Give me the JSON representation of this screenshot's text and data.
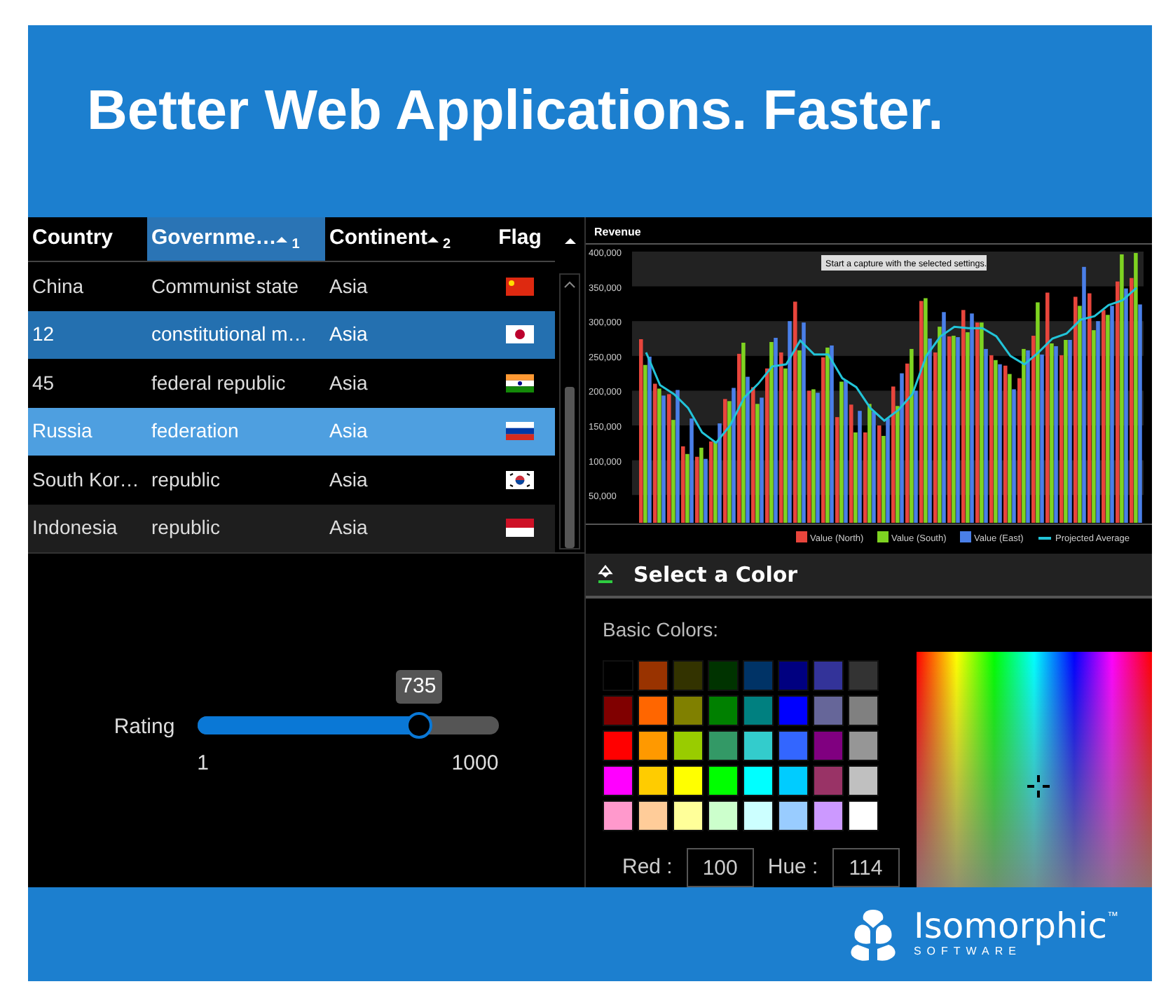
{
  "banner": {
    "title": "Better Web Applications. Faster."
  },
  "grid": {
    "columns": [
      {
        "label": "Country",
        "highlighted": false
      },
      {
        "label": "Governme…",
        "sort_rank": "1",
        "highlighted": true
      },
      {
        "label": "Continent",
        "sort_rank": "2",
        "highlighted": false
      },
      {
        "label": "Flag",
        "highlighted": false
      }
    ],
    "rows": [
      {
        "country": "China",
        "government": "Communist state",
        "continent": "Asia",
        "kind": "cn",
        "selected": false,
        "hovered": false,
        "shaded": false
      },
      {
        "country": "12",
        "government": "constitutional m…",
        "continent": "Asia",
        "kind": "jp",
        "selected": true,
        "hovered": false,
        "shaded": false
      },
      {
        "country": "45",
        "government": "federal republic",
        "continent": "Asia",
        "kind": "in",
        "selected": false,
        "hovered": false,
        "shaded": false
      },
      {
        "country": "Russia",
        "government": "federation",
        "continent": "Asia",
        "kind": "ru",
        "selected": false,
        "hovered": true,
        "shaded": false
      },
      {
        "country": "South Kor…",
        "government": "republic",
        "continent": "Asia",
        "kind": "kr",
        "selected": false,
        "hovered": false,
        "shaded": false
      },
      {
        "country": "Indonesia",
        "government": "republic",
        "continent": "Asia",
        "kind": "id",
        "selected": false,
        "hovered": false,
        "shaded": true
      }
    ]
  },
  "revenue": {
    "tooltip": "Start a capture with the selected settings.",
    "chart_data": {
      "type": "bar",
      "title": "Revenue",
      "ylim": [
        10000,
        405000
      ],
      "yticks": [
        {
          "value": 50000,
          "label": "50,000"
        },
        {
          "value": 100000,
          "label": "100,000"
        },
        {
          "value": 150000,
          "label": "150,000"
        },
        {
          "value": 200000,
          "label": "200,000"
        },
        {
          "value": 250000,
          "label": "250,000"
        },
        {
          "value": 300000,
          "label": "300,000"
        },
        {
          "value": 350000,
          "label": "350,000"
        },
        {
          "value": 400000,
          "label": "400,000"
        }
      ],
      "legend": "bottom-right",
      "series": [
        {
          "name": "Value (North)",
          "color": "#e8453c",
          "values": [
            274000,
            210000,
            195000,
            120000,
            105000,
            127000,
            188000,
            253000,
            205000,
            232000,
            255000,
            328000,
            200000,
            248000,
            162000,
            180000,
            140000,
            150000,
            206000,
            239000,
            329000,
            255000,
            278000,
            316000,
            298000,
            251000,
            236000,
            218000,
            279000,
            341000,
            251000,
            335000,
            340000,
            316000,
            357000,
            362000
          ]
        },
        {
          "name": "Value (South)",
          "color": "#7ed321",
          "values": [
            237000,
            203000,
            158000,
            109000,
            118000,
            127000,
            185000,
            269000,
            181000,
            270000,
            232000,
            258000,
            202000,
            262000,
            213000,
            140000,
            181000,
            135000,
            178000,
            260000,
            333000,
            292000,
            279000,
            284000,
            298000,
            244000,
            224000,
            260000,
            327000,
            268000,
            273000,
            322000,
            287000,
            309000,
            396000,
            398000
          ]
        },
        {
          "name": "Value (East)",
          "color": "#4a7fe8",
          "values": [
            249000,
            193000,
            201000,
            160000,
            102000,
            153000,
            204000,
            220000,
            190000,
            276000,
            300000,
            298000,
            197000,
            265000,
            215000,
            171000,
            170000,
            160000,
            225000,
            200000,
            275000,
            313000,
            277000,
            311000,
            260000,
            238000,
            202000,
            258000,
            252000,
            264000,
            273000,
            378000,
            300000,
            322000,
            347000,
            324000
          ]
        },
        {
          "name": "Projected Average",
          "type": "line",
          "color": "#22c4d8",
          "values": [
            255000,
            208000,
            195000,
            175000,
            140000,
            125000,
            150000,
            190000,
            210000,
            235000,
            238000,
            272000,
            252000,
            252000,
            218000,
            205000,
            175000,
            157000,
            172000,
            195000,
            250000,
            278000,
            292000,
            290000,
            290000,
            278000,
            250000,
            238000,
            255000,
            275000,
            282000,
            302000,
            307000,
            323000,
            330000,
            348000
          ]
        }
      ]
    }
  },
  "slider": {
    "label": "Rating",
    "value": "735",
    "level": 0.735,
    "min": "1",
    "max": "1000"
  },
  "color_picker": {
    "title": "Select a Color",
    "basic_label": "Basic Colors:",
    "swatches": [
      {
        "color": "#000000"
      },
      {
        "color": "#993300"
      },
      {
        "color": "#333300"
      },
      {
        "color": "#003300"
      },
      {
        "color": "#003366"
      },
      {
        "color": "#000080"
      },
      {
        "color": "#333399"
      },
      {
        "color": "#333333"
      },
      {
        "color": "#800000"
      },
      {
        "color": "#ff6600"
      },
      {
        "color": "#808000"
      },
      {
        "color": "#008000"
      },
      {
        "color": "#008080"
      },
      {
        "color": "#0000ff"
      },
      {
        "color": "#666699"
      },
      {
        "color": "#808080"
      },
      {
        "color": "#ff0000"
      },
      {
        "color": "#ff9900"
      },
      {
        "color": "#99cc00"
      },
      {
        "color": "#339966"
      },
      {
        "color": "#33cccc"
      },
      {
        "color": "#3366ff"
      },
      {
        "color": "#800080"
      },
      {
        "color": "#969696"
      },
      {
        "color": "#ff00ff"
      },
      {
        "color": "#ffcc00"
      },
      {
        "color": "#ffff00"
      },
      {
        "color": "#00ff00"
      },
      {
        "color": "#00ffff"
      },
      {
        "color": "#00ccff"
      },
      {
        "color": "#993366"
      },
      {
        "color": "#c0c0c0"
      },
      {
        "color": "#ff99cc"
      },
      {
        "color": "#ffcc99"
      },
      {
        "color": "#ffff99"
      },
      {
        "color": "#ccffcc"
      },
      {
        "color": "#ccffff"
      },
      {
        "color": "#99ccff"
      },
      {
        "color": "#cc99ff"
      },
      {
        "color": "#ffffff"
      }
    ],
    "fields": [
      {
        "label": "Red :",
        "value": "100"
      },
      {
        "label": "Hue :",
        "value": "114"
      }
    ]
  },
  "footer": {
    "logo_name": "Isomorphic",
    "logo_mark": "™",
    "logo_sub": "SOFTWARE"
  }
}
